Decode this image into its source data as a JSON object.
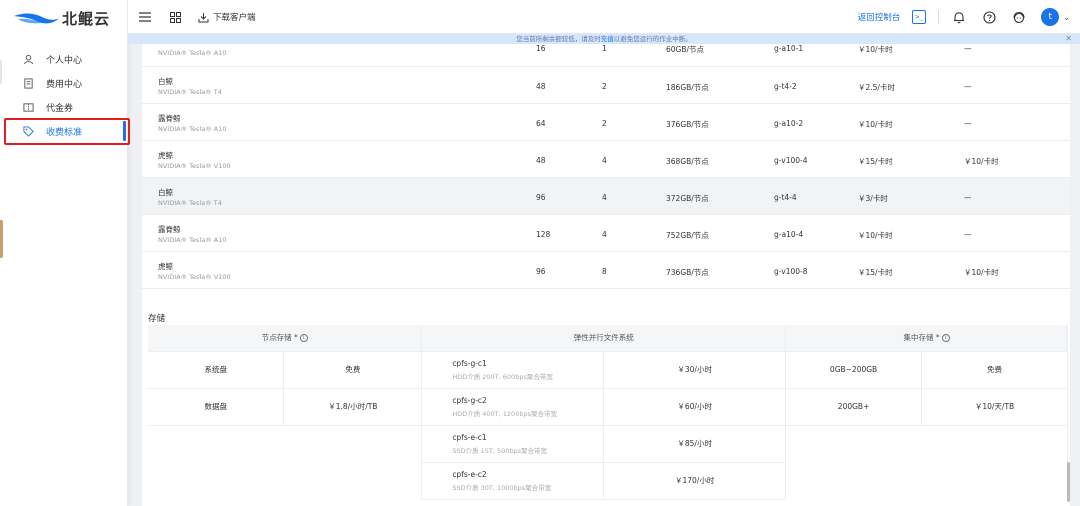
{
  "brand": {
    "name": "北鲲云"
  },
  "sidebar": {
    "items": [
      {
        "label": "个人中心",
        "icon": "user-icon"
      },
      {
        "label": "费用中心",
        "icon": "bill-icon"
      },
      {
        "label": "代金券",
        "icon": "voucher-icon"
      },
      {
        "label": "收费标准",
        "icon": "tag-icon",
        "active": true
      }
    ]
  },
  "topbar": {
    "download_label": "下载客户端",
    "console_link": "返回控制台",
    "terminal_glyph": ">_",
    "avatar_letter": "t"
  },
  "notice": {
    "part1": "您当前所剩余额较低，请及时",
    "link": "充值",
    "part2": "以避免您运行的作业中断。"
  },
  "gpu_table": {
    "rows": [
      {
        "name": "",
        "model": "NVIDIA® Tesla® A10",
        "cpu": "16",
        "gpu": "1",
        "mem": "60GB/节点",
        "spec": "g-a10-1",
        "price": "￥10/卡时",
        "other": "—"
      },
      {
        "name": "白鲸",
        "model": "NVIDIA® Tesla® T4",
        "cpu": "48",
        "gpu": "2",
        "mem": "186GB/节点",
        "spec": "g-t4-2",
        "price": "￥2.5/卡时",
        "other": "—"
      },
      {
        "name": "露脊鲸",
        "model": "NVIDIA® Tesla® A10",
        "cpu": "64",
        "gpu": "2",
        "mem": "376GB/节点",
        "spec": "g-a10-2",
        "price": "￥10/卡时",
        "other": "—"
      },
      {
        "name": "虎鲸",
        "model": "NVIDIA® Tesla® V100",
        "cpu": "48",
        "gpu": "4",
        "mem": "368GB/节点",
        "spec": "g-v100-4",
        "price": "￥15/卡时",
        "other": "￥10/卡时"
      },
      {
        "name": "白鲸",
        "model": "NVIDIA® Tesla® T4",
        "cpu": "96",
        "gpu": "4",
        "mem": "372GB/节点",
        "spec": "g-t4-4",
        "price": "￥3/卡时",
        "other": "—"
      },
      {
        "name": "露脊鲸",
        "model": "NVIDIA® Tesla® A10",
        "cpu": "128",
        "gpu": "4",
        "mem": "752GB/节点",
        "spec": "g-a10-4",
        "price": "￥10/卡时",
        "other": "—"
      },
      {
        "name": "虎鲸",
        "model": "NVIDIA® Tesla® V100",
        "cpu": "96",
        "gpu": "8",
        "mem": "736GB/节点",
        "spec": "g-v100-8",
        "price": "￥15/卡时",
        "other": "￥10/卡时"
      }
    ]
  },
  "storage": {
    "title": "存储",
    "headers": {
      "node": "节点存储 *",
      "parallel": "弹性并行文件系统",
      "central": "集中存储 *"
    },
    "node_rows": [
      {
        "label": "系统盘",
        "value": "免费"
      },
      {
        "label": "数据盘",
        "value": "￥1.8/小时/TB"
      }
    ],
    "parallel_rows": [
      {
        "name": "cpfs-g-c1",
        "desc": "HDD介质 200T, 600bps聚合带宽",
        "price": "￥30/小时"
      },
      {
        "name": "cpfs-g-c2",
        "desc": "HDD介质 400T, 1200bps聚合带宽",
        "price": "￥60/小时"
      },
      {
        "name": "cpfs-e-c1",
        "desc": "SSD介质 15T, 500bps聚合带宽",
        "price": "￥85/小时"
      },
      {
        "name": "cpfs-e-c2",
        "desc": "SSD介质 30T, 1000bps聚合带宽",
        "price": "￥170/小时"
      }
    ],
    "central_rows": [
      {
        "range": "0GB~200GB",
        "price": "免费"
      },
      {
        "range": "200GB+",
        "price": "￥10/天/TB"
      }
    ]
  },
  "colors": {
    "accent": "#1a73e8",
    "highlight": "#e02020",
    "notice_bg": "#d8e6fb"
  }
}
